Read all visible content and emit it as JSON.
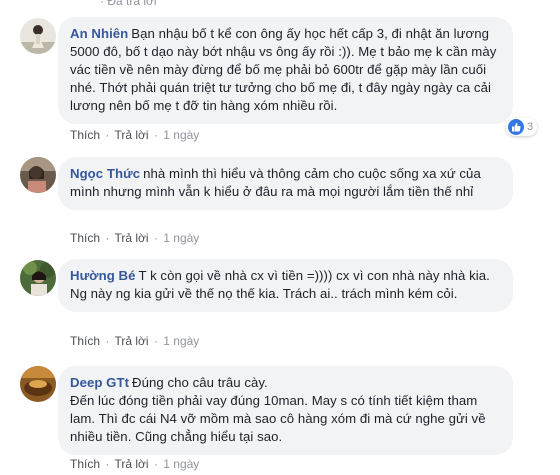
{
  "header": {
    "cut_text": "· Đã trả lời"
  },
  "comments": [
    {
      "author": "An Nhiên",
      "text": "Bạn nhậu bố t kể con ông ấy học hết cấp 3, đi nhật ăn lương 5000 đô, bố t dạo này bớt nhậu vs ông ấy rồi :)). Mẹ t bảo mẹ k cần mày vác tiền về nên mày đừng để bố mẹ phải bỏ 600tr để gặp mày lần cuối nhé. Thớt phải quán triệt tư tưởng cho bố mẹ đi, t đây ngày ngày ca cải lương nên bố mẹ t đỡ tin hàng xóm nhiều rồi.",
      "like_label": "Thích",
      "reply_label": "Trả lời",
      "time": "1 ngày",
      "reaction_count": "3"
    },
    {
      "author": "Ngọc Thức",
      "text": "nhà mình thì hiểu và thông cảm cho cuộc sống xa xứ của mình nhưng mình vẫn k hiểu ở đâu ra mà mọi người lắm tiền thế nhỉ",
      "like_label": "Thích",
      "reply_label": "Trả lời",
      "time": "1 ngày"
    },
    {
      "author": "Hường Bé",
      "text": "T k còn gọi về nhà cx vì tiền =)))) cx vì con nhà này nhà kia. Ng này ng kia gửi về thế nọ thế kia. Trách ai.. trách mình kém cỏi.",
      "like_label": "Thích",
      "reply_label": "Trả lời",
      "time": "1 ngày"
    },
    {
      "author": "Deep GTt",
      "text_line1": "Đúng cho câu trâu cày.",
      "text_rest": "Đến lúc đóng tiền phải vay đúng 10man. May s có tính tiết kiệm tham lam. Thì đc cái N4 vỡ mồm mà sao cô hàng xóm đi mà cứ nghe gửi về nhiều tiền. Cũng chẳng hiểu tại sao.",
      "like_label": "Thích",
      "reply_label": "Trả lời",
      "time": "1 ngày"
    }
  ],
  "separator": "·",
  "colors": {
    "author": "#365899",
    "bubble": "#f2f3f5",
    "meta": "#90949c",
    "like": "#3578e5"
  }
}
